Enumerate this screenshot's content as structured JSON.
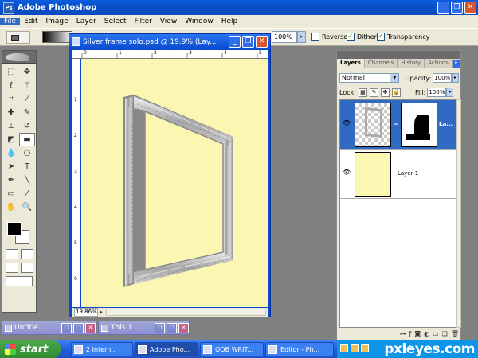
{
  "app": {
    "title": "Adobe Photoshop",
    "logo": "Ps",
    "window_buttons": {
      "minimize": "_",
      "restore": "❐",
      "close": "✕"
    }
  },
  "menu": [
    "File",
    "Edit",
    "Image",
    "Layer",
    "Select",
    "Filter",
    "View",
    "Window",
    "Help"
  ],
  "options_bar": {
    "opacity": "100%",
    "reverse_label": "Reverse",
    "reverse_checked": false,
    "dither_label": "Dither",
    "dither_checked": true,
    "transparency_label": "Transparency",
    "transparency_checked": true
  },
  "document": {
    "title": "Silver frame solo.psd @ 19.9% (Lay...",
    "zoom": "19.86%",
    "ruler_top": [
      "0",
      "1",
      "2",
      "3",
      "4",
      "5"
    ],
    "ruler_left": [
      "1",
      "2",
      "3",
      "4",
      "5",
      "6"
    ],
    "canvas_color": "#fbf7b2"
  },
  "layers_panel": {
    "tabs": [
      "Layers",
      "Channels",
      "History",
      "Actions"
    ],
    "blend_mode": "Normal",
    "opacity_label": "Opacity:",
    "opacity": "100%",
    "lock_label": "Lock:",
    "fill_label": "Fill:",
    "fill": "100%",
    "layers": [
      {
        "name": "La...",
        "selected": true
      },
      {
        "name": "Layer 1",
        "selected": false
      }
    ]
  },
  "minimized": [
    {
      "title": "Untitle..."
    },
    {
      "title": "This 1 ..."
    }
  ],
  "taskbar": {
    "start": "start",
    "tasks": [
      {
        "label": "2 Intern...",
        "active": false
      },
      {
        "label": "Adobe Pho...",
        "active": true
      },
      {
        "label": "OOB WRIT...",
        "active": false
      },
      {
        "label": "Editor - Ph...",
        "active": false
      }
    ],
    "watermark": "pxleyes.com"
  },
  "colors": {
    "xp_blue": "#0a4ad0",
    "canvas_yellow": "#fbf7b2",
    "panel_bg": "#ece9d8",
    "selection": "#316ac5"
  }
}
